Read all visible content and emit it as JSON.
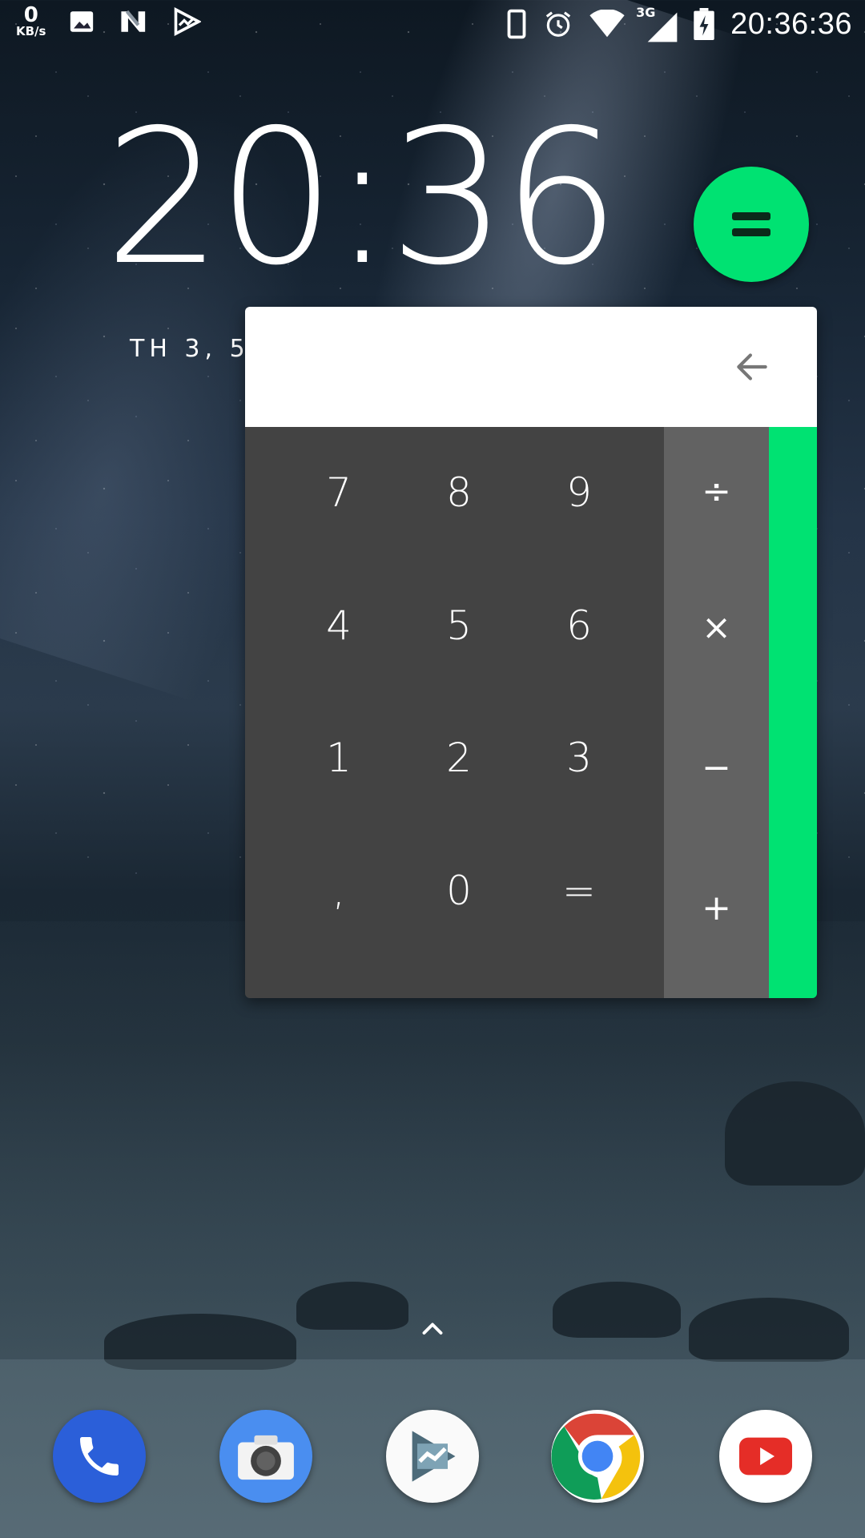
{
  "status_bar": {
    "net_speed_value": "0",
    "net_speed_unit": "KB/s",
    "network_type": "3G",
    "time": "20:36:36",
    "left_icons": [
      "image-icon",
      "n-notification-icon",
      "play-analytics-icon"
    ],
    "right_icons": [
      "vibrate-icon",
      "alarm-icon",
      "wifi-icon",
      "signal-icon",
      "battery-charging-icon"
    ]
  },
  "lockscreen": {
    "clock": "20:36",
    "date": "TH 3, 5"
  },
  "calculator": {
    "display_value": "",
    "backspace_icon": "backspace-arrow-icon",
    "numpad": [
      [
        "7",
        "8",
        "9"
      ],
      [
        "4",
        "5",
        "6"
      ],
      [
        "1",
        "2",
        "3"
      ],
      [
        ",",
        "0",
        "="
      ]
    ],
    "operators": [
      "÷",
      "×",
      "−",
      "+"
    ],
    "accent_color": "#00e272",
    "fab_icon": "equals-icon"
  },
  "home": {
    "app_drawer_icon": "chevron-up-icon",
    "dock": [
      "Phone",
      "Camera",
      "Play Console",
      "Chrome",
      "YouTube"
    ]
  }
}
